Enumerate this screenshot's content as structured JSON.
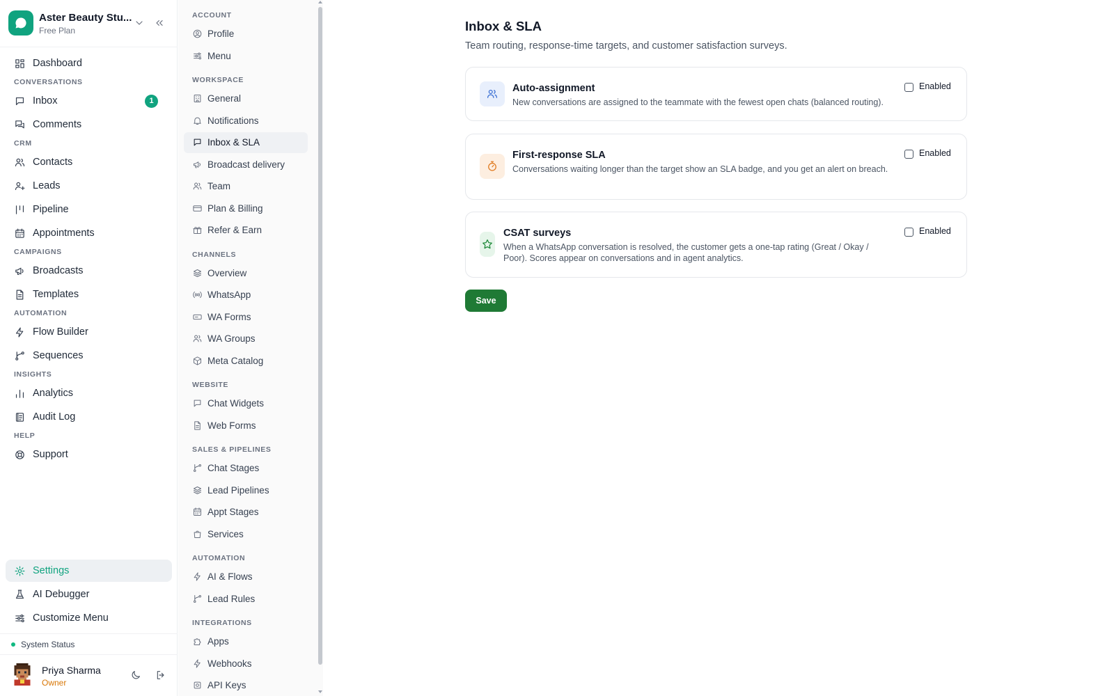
{
  "workspace": {
    "name": "Aster Beauty Stu...",
    "plan": "Free Plan"
  },
  "sidebar": {
    "items": [
      {
        "label": "Dashboard",
        "icon": "dashboard-icon"
      },
      {
        "section": "CONVERSATIONS"
      },
      {
        "label": "Inbox",
        "icon": "inbox-icon",
        "badge": "1"
      },
      {
        "label": "Comments",
        "icon": "comments-icon"
      },
      {
        "section": "CRM"
      },
      {
        "label": "Contacts",
        "icon": "contacts-icon"
      },
      {
        "label": "Leads",
        "icon": "leads-icon"
      },
      {
        "label": "Pipeline",
        "icon": "pipeline-icon"
      },
      {
        "label": "Appointments",
        "icon": "calendar-icon"
      },
      {
        "section": "CAMPAIGNS"
      },
      {
        "label": "Broadcasts",
        "icon": "megaphone-icon"
      },
      {
        "label": "Templates",
        "icon": "document-icon"
      },
      {
        "section": "AUTOMATION"
      },
      {
        "label": "Flow Builder",
        "icon": "lightning-icon"
      },
      {
        "label": "Sequences",
        "icon": "branch-icon"
      },
      {
        "section": "INSIGHTS"
      },
      {
        "label": "Analytics",
        "icon": "bar-chart-icon"
      },
      {
        "label": "Audit Log",
        "icon": "audit-log-icon"
      },
      {
        "section": "HELP"
      },
      {
        "label": "Support",
        "icon": "lifebuoy-icon"
      }
    ],
    "bottom": [
      {
        "label": "Settings",
        "icon": "gear-icon",
        "active": true
      },
      {
        "label": "AI Debugger",
        "icon": "flask-icon"
      },
      {
        "label": "Customize Menu",
        "icon": "sliders-icon"
      }
    ],
    "system_status": "System Status"
  },
  "user": {
    "name": "Priya Sharma",
    "role": "Owner"
  },
  "settings_nav": {
    "groups": [
      {
        "section": "ACCOUNT",
        "items": [
          {
            "label": "Profile",
            "icon": "user-circle-icon"
          },
          {
            "label": "Menu",
            "icon": "sliders-icon"
          }
        ]
      },
      {
        "section": "WORKSPACE",
        "items": [
          {
            "label": "General",
            "icon": "building-icon"
          },
          {
            "label": "Notifications",
            "icon": "bell-icon"
          },
          {
            "label": "Inbox & SLA",
            "icon": "chat-icon",
            "active": true
          },
          {
            "label": "Broadcast delivery",
            "icon": "megaphone-icon"
          },
          {
            "label": "Team",
            "icon": "users-icon"
          },
          {
            "label": "Plan & Billing",
            "icon": "credit-card-icon"
          },
          {
            "label": "Refer & Earn",
            "icon": "gift-icon"
          }
        ]
      },
      {
        "section": "CHANNELS",
        "items": [
          {
            "label": "Overview",
            "icon": "layers-icon"
          },
          {
            "label": "WhatsApp",
            "icon": "radio-icon"
          },
          {
            "label": "WA Forms",
            "icon": "form-icon"
          },
          {
            "label": "WA Groups",
            "icon": "users-icon"
          },
          {
            "label": "Meta Catalog",
            "icon": "box-icon"
          }
        ]
      },
      {
        "section": "WEBSITE",
        "items": [
          {
            "label": "Chat Widgets",
            "icon": "chat-icon"
          },
          {
            "label": "Web Forms",
            "icon": "document-icon"
          }
        ]
      },
      {
        "section": "SALES & PIPELINES",
        "items": [
          {
            "label": "Chat Stages",
            "icon": "branch-icon"
          },
          {
            "label": "Lead Pipelines",
            "icon": "layers-icon"
          },
          {
            "label": "Appt Stages",
            "icon": "calendar-icon"
          },
          {
            "label": "Services",
            "icon": "bag-icon"
          }
        ]
      },
      {
        "section": "AUTOMATION",
        "items": [
          {
            "label": "AI & Flows",
            "icon": "lightning-icon"
          },
          {
            "label": "Lead Rules",
            "icon": "branch-icon"
          }
        ]
      },
      {
        "section": "INTEGRATIONS",
        "items": [
          {
            "label": "Apps",
            "icon": "puzzle-icon"
          },
          {
            "label": "Webhooks",
            "icon": "webhook-icon"
          },
          {
            "label": "API Keys",
            "icon": "key-icon"
          }
        ]
      }
    ]
  },
  "page": {
    "title": "Inbox & SLA",
    "subtitle": "Team routing, response-time targets, and customer satisfaction surveys.",
    "cards": [
      {
        "title": "Auto-assignment",
        "description": "New conversations are assigned to the teammate with the fewest open chats (balanced routing).",
        "toggle_label": "Enabled",
        "enabled": false,
        "icon": "users-icon",
        "icon_color": "#3b6fd4",
        "icon_bg": "#e8effc"
      },
      {
        "title": "First-response SLA",
        "description": "Conversations waiting longer than the target show an SLA badge, and you get an alert on breach.",
        "toggle_label": "Enabled",
        "enabled": false,
        "icon": "stopwatch-icon",
        "icon_color": "#e07a1f",
        "icon_bg": "#fdeee0"
      },
      {
        "title": "CSAT surveys",
        "description": "When a WhatsApp conversation is resolved, the customer gets a one-tap rating (Great / Okay / Poor). Scores appear on conversations and in agent analytics.",
        "toggle_label": "Enabled",
        "enabled": false,
        "icon": "star-icon",
        "icon_color": "#1f8a3a",
        "icon_bg": "#e6f5ea"
      }
    ],
    "save_label": "Save"
  },
  "colors": {
    "accent": "#10a37f",
    "save": "#1f7a35",
    "owner": "#d97706"
  }
}
